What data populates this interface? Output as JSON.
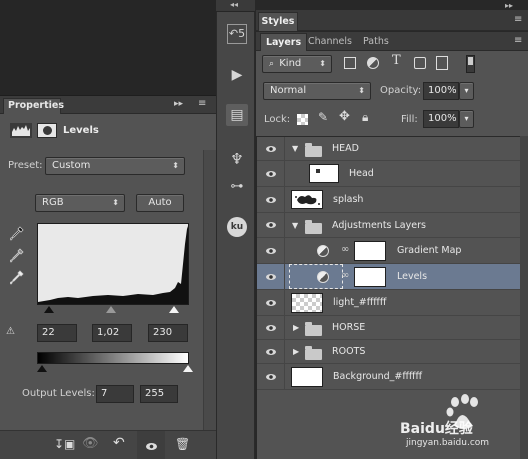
{
  "properties": {
    "tab": "Properties",
    "panel_title": "Levels",
    "preset_label": "Preset:",
    "preset_value": "Custom",
    "channel_value": "RGB",
    "auto_label": "Auto",
    "input_black": "22",
    "input_gamma": "1,02",
    "input_white": "230",
    "output_label": "Output Levels:",
    "output_black": "7",
    "output_white": "255"
  },
  "right_panels": {
    "styles_tab": "Styles",
    "tabs": [
      "Layers",
      "Channels",
      "Paths"
    ],
    "filter_value": "Kind",
    "blend_mode": "Normal",
    "opacity_label": "Opacity:",
    "opacity_value": "100%",
    "lock_label": "Lock:",
    "fill_label": "Fill:",
    "fill_value": "100%"
  },
  "layers": [
    {
      "name": "HEAD",
      "kind": "group",
      "expanded": true
    },
    {
      "name": "Head",
      "kind": "layer"
    },
    {
      "name": "splash",
      "kind": "layer"
    },
    {
      "name": "Adjustments Layers",
      "kind": "group",
      "expanded": true
    },
    {
      "name": "Gradient Map",
      "kind": "adjustment"
    },
    {
      "name": "Levels",
      "kind": "adjustment",
      "selected": true
    },
    {
      "name": "light_#ffffff",
      "kind": "layer"
    },
    {
      "name": "HORSE",
      "kind": "group",
      "expanded": false
    },
    {
      "name": "ROOTS",
      "kind": "group",
      "expanded": false
    },
    {
      "name": "Background_#ffffff",
      "kind": "layer"
    }
  ],
  "watermark": {
    "brand": "Baidu经验",
    "url": "jingyan.baidu.com"
  },
  "colors": {
    "selected_row": "#6b7a91",
    "panel_bg": "#535353"
  }
}
